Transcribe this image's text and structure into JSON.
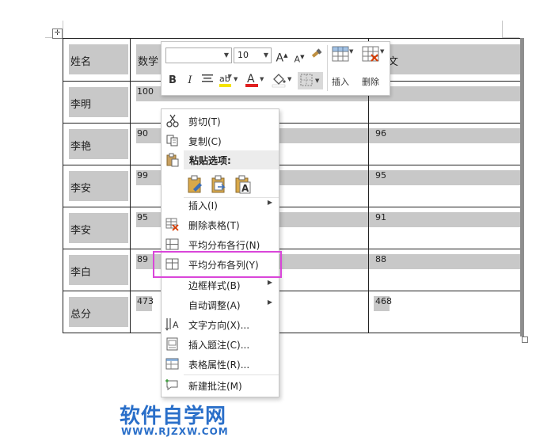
{
  "table": {
    "header": [
      "姓名",
      "数学",
      "文"
    ],
    "rows": [
      {
        "name": "李明",
        "c1": "100",
        "c3": ""
      },
      {
        "name": "李艳",
        "c1": "90",
        "c3": "96"
      },
      {
        "name": "李安",
        "c1": "99",
        "c3": "95"
      },
      {
        "name": "李安",
        "c1": "95",
        "c3": "91"
      },
      {
        "name": "李白",
        "c1": "89",
        "c3": "88"
      },
      {
        "name": "总分",
        "c1": "473",
        "c3": "468"
      }
    ]
  },
  "mini_toolbar": {
    "font_name": "",
    "font_size": "10",
    "grow_font": "A",
    "shrink_font": "A",
    "bold": "B",
    "italic": "I",
    "font_color_letter": "A",
    "insert_label": "插入",
    "delete_label": "删除",
    "colors": {
      "highlight": "#f5e400",
      "font_color": "#e02020"
    }
  },
  "context_menu": {
    "items": [
      {
        "label": "剪切(T)",
        "icon": "scissors-icon"
      },
      {
        "label": "复制(C)",
        "icon": "copy-icon"
      },
      {
        "label": "粘贴选项:",
        "icon": "paste-icon"
      },
      {
        "label": "插入(I)",
        "icon": "none",
        "submenu": true
      },
      {
        "label": "删除表格(T)",
        "icon": "delete-table-icon"
      },
      {
        "label": "平均分布各行(N)",
        "icon": "distribute-rows-icon"
      },
      {
        "label": "平均分布各列(Y)",
        "icon": "distribute-columns-icon"
      },
      {
        "label": "边框样式(B)",
        "icon": "none",
        "submenu": true
      },
      {
        "label": "自动调整(A)",
        "icon": "none",
        "submenu": true
      },
      {
        "label": "文字方向(X)...",
        "icon": "text-direction-icon"
      },
      {
        "label": "插入题注(C)...",
        "icon": "insert-caption-icon"
      },
      {
        "label": "表格属性(R)...",
        "icon": "table-properties-icon"
      },
      {
        "label": "新建批注(M)",
        "icon": "new-comment-icon"
      }
    ],
    "paste_options": [
      "keep-source-formatting-icon",
      "merge-formatting-icon",
      "keep-text-only-icon"
    ],
    "highlight_color": "#d946d9"
  },
  "watermark": {
    "title": "软件自学网",
    "url": "WWW.RJZXW.COM",
    "color": "#2a6fc9"
  }
}
